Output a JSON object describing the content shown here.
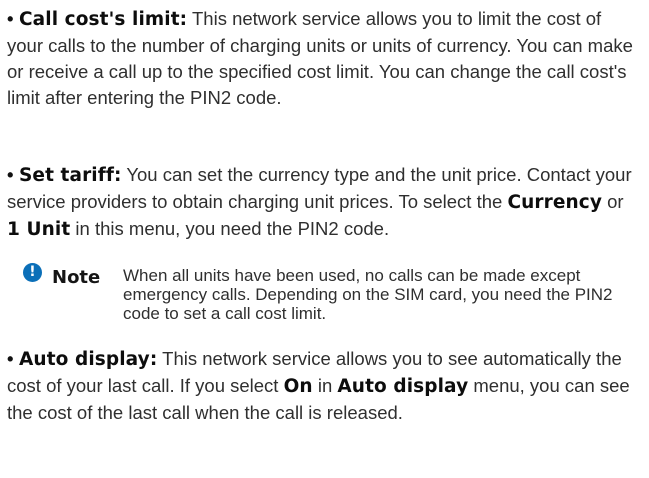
{
  "items": [
    {
      "bullet": "•",
      "segments": [
        {
          "text": "Call cost's limit:",
          "bold": true
        },
        {
          "text": " This network service allows you to limit the cost of your calls to the number of charging units or units of currency. You can make or receive a call up to the specified cost limit. You can change the call cost's limit after entering the PIN2 code.",
          "bold": false
        }
      ]
    },
    {
      "bullet": "•",
      "segments": [
        {
          "text": "Set tariff:",
          "bold": true
        },
        {
          "text": " You can set the currency type and the unit price. Contact your service providers to obtain charging unit prices. To select the ",
          "bold": false
        },
        {
          "text": "Currency",
          "bold": true
        },
        {
          "text": " or ",
          "bold": false
        },
        {
          "text": "1 Unit",
          "bold": true
        },
        {
          "text": " in this menu, you need the PIN2 code.",
          "bold": false
        }
      ]
    },
    {
      "bullet": "•",
      "segments": [
        {
          "text": "Auto display:",
          "bold": true
        },
        {
          "text": " This network service allows you to see automatically the cost of your last call. If you select ",
          "bold": false
        },
        {
          "text": "On",
          "bold": true
        },
        {
          "text": " in ",
          "bold": false
        },
        {
          "text": "Auto display",
          "bold": true
        },
        {
          "text": " menu, you can see the cost of the last call when the call is released.",
          "bold": false
        }
      ]
    }
  ],
  "note": {
    "icon": "exclamation-circle-icon",
    "icon_glyph": "!",
    "icon_color": "#0b6fb8",
    "label": "Note",
    "text": "When all units have been used, no calls can be made except emergency calls. Depending on the SIM card, you need the PIN2 code to set a call cost limit."
  }
}
